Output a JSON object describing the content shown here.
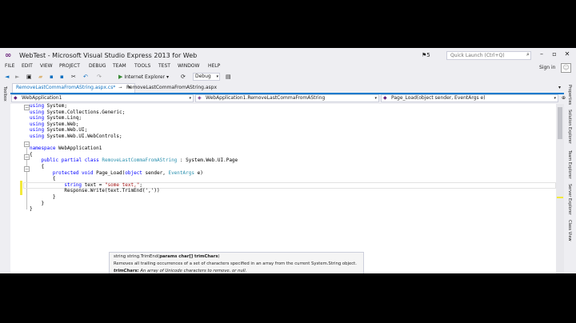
{
  "window": {
    "title": "WebTest - Microsoft Visual Studio Express 2013 for Web",
    "feedback_count": "5",
    "quick_launch_placeholder": "Quick Launch (Ctrl+Q)",
    "sign_in": "Sign in",
    "accent": "#007acc",
    "brand": "#68217a"
  },
  "menu": [
    "FILE",
    "EDIT",
    "VIEW",
    "PROJECT",
    "DEBUG",
    "TEAM",
    "TOOLS",
    "TEST",
    "WINDOW",
    "HELP"
  ],
  "toolbar": {
    "run_label": "Internet Explorer",
    "config_value": "Debug"
  },
  "left_tool_tabs": [
    "Toolbox"
  ],
  "right_tool_tabs": [
    "Properties",
    "Solution Explorer",
    "Team Explorer",
    "Server Explorer",
    "Class View"
  ],
  "tabs": [
    {
      "label": "RemoveLastCommaFromAString.aspx.cs*",
      "state": "active"
    },
    {
      "label": "RemoveLastCommaFromAString.aspx",
      "state": "preview"
    }
  ],
  "nav": {
    "project": "WebApplication1",
    "type": "WebApplication1.RemoveLastCommaFromAString",
    "member": "Page_Load(object sender, EventArgs e)"
  },
  "code": {
    "using": "using",
    "ns_system": " System;",
    "ns_collections": " System.Collections.Generic;",
    "ns_linq": " System.Linq;",
    "ns_web": " System.Web;",
    "ns_webui": " System.Web.UI;",
    "ns_webcontrols": " System.Web.UI.WebControls;",
    "namespace_kw": "namespace",
    "namespace_name": " WebApplication1",
    "open_brace": "{",
    "close_brace": "}",
    "public_kw": "public",
    "partial_kw": "partial",
    "class_kw": "class",
    "class_name": "RemoveLastCommaFromAString",
    "base_class": " : System.Web.UI.Page",
    "protected_kw": "protected",
    "void_kw": "void",
    "method_sig_a": " Page_Load(",
    "object_kw": "object",
    "method_sig_b": " sender, ",
    "eventargs": "EventArgs",
    "method_sig_c": " e)",
    "string_kw": "string",
    "var_decl": " text = ",
    "string_literal": "\"some text,\"",
    "semicolon": ";",
    "response_line": "Response.Write(text.TrimEnd(','))"
  },
  "tooltip": {
    "signature_prefix": "string string.TrimEnd(",
    "signature_param": "params char[] trimChars",
    "signature_suffix": ")",
    "description": "Removes all trailing occurrences of a set of characters specified in an array from the current System.String object.",
    "param_name": "trimChars:",
    "param_desc": " An array of Unicode characters to remove, or null."
  }
}
